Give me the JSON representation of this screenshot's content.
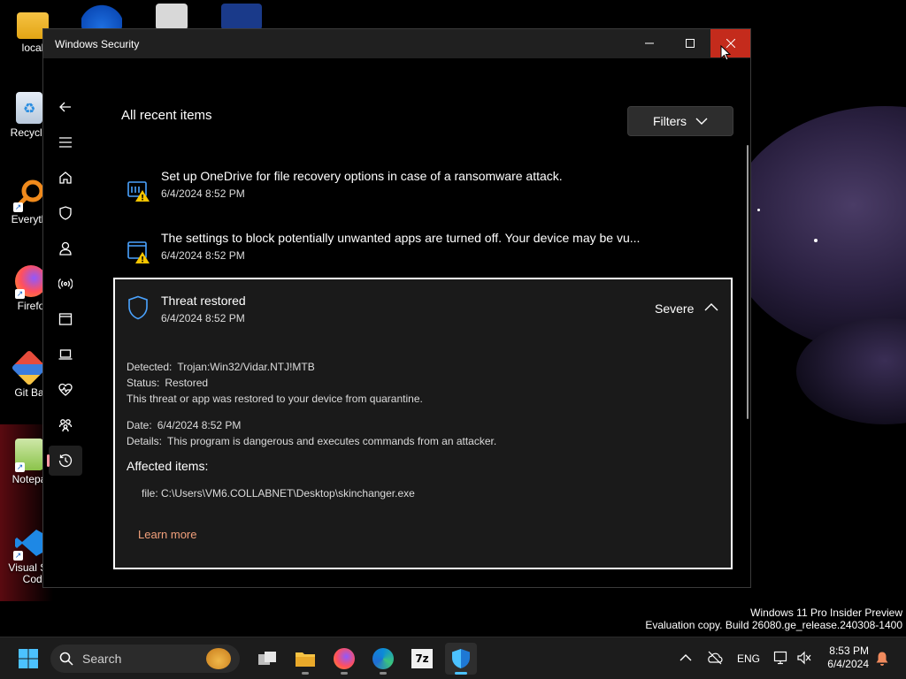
{
  "window": {
    "title": "Windows Security",
    "controls": {
      "minimize": "—",
      "maximize": "☐",
      "close": "✕"
    }
  },
  "page": {
    "title": "All recent items",
    "filters_label": "Filters"
  },
  "nav": [
    {
      "name": "back-icon"
    },
    {
      "name": "menu-icon"
    },
    {
      "name": "home-icon"
    },
    {
      "name": "virus-protection-icon"
    },
    {
      "name": "account-protection-icon"
    },
    {
      "name": "firewall-network-icon"
    },
    {
      "name": "app-browser-control-icon"
    },
    {
      "name": "device-security-icon"
    },
    {
      "name": "device-health-icon"
    },
    {
      "name": "family-options-icon"
    },
    {
      "name": "protection-history-icon",
      "active": true
    },
    {
      "name": "settings-icon"
    }
  ],
  "items": [
    {
      "title": "Set up OneDrive for file recovery options in case of a ransomware attack.",
      "date": "6/4/2024 8:52 PM",
      "icon": "onedrive-warning-icon"
    },
    {
      "title": "The settings to block potentially unwanted apps are turned off. Your device may be vu...",
      "date": "6/4/2024 8:52 PM",
      "icon": "app-warning-icon"
    }
  ],
  "threat": {
    "title": "Threat restored",
    "date": "6/4/2024 8:52 PM",
    "severity": "Severe",
    "detected_label": "Detected:",
    "detected_value": "Trojan:Win32/Vidar.NTJ!MTB",
    "status_label": "Status:",
    "status_value": "Restored",
    "status_text": "This threat or app was restored to your device from quarantine.",
    "date_label": "Date:",
    "date_value": "6/4/2024 8:52 PM",
    "details_label": "Details:",
    "details_value": "This program is dangerous and executes commands from an attacker.",
    "affected_label": "Affected items:",
    "file_line": "file: C:\\Users\\VM6.COLLABNET\\Desktop\\skinchanger.exe",
    "learn_more": "Learn more"
  },
  "desktop_icons": [
    {
      "label": "local",
      "icon": "folder-icon"
    },
    {
      "label": "Recycle",
      "icon": "recycle-bin-icon"
    },
    {
      "label": "Everyth",
      "icon": "everything-search-icon"
    },
    {
      "label": "Firefo",
      "icon": "firefox-icon"
    },
    {
      "label": "Git Ba",
      "icon": "git-bash-icon"
    },
    {
      "label": "Notepa",
      "icon": "notepad-plus-plus-icon"
    },
    {
      "label": "Visual St",
      "label2": "Code",
      "icon": "vscode-icon"
    }
  ],
  "watermark": {
    "line1": "Windows 11 Pro Insider Preview",
    "line2": "Evaluation copy. Build 26080.ge_release.240308-1400"
  },
  "taskbar": {
    "search_placeholder": "Search",
    "language": "ENG",
    "time": "8:53 PM",
    "date": "6/4/2024",
    "accent": "#4cc2ff"
  },
  "colors": {
    "close_button": "#c42b1c",
    "warning": "#f7c600",
    "accent_blue": "#4aa3ff",
    "learn_more": "#f2a07b",
    "active_nav_indicator": "#ff99a4"
  }
}
